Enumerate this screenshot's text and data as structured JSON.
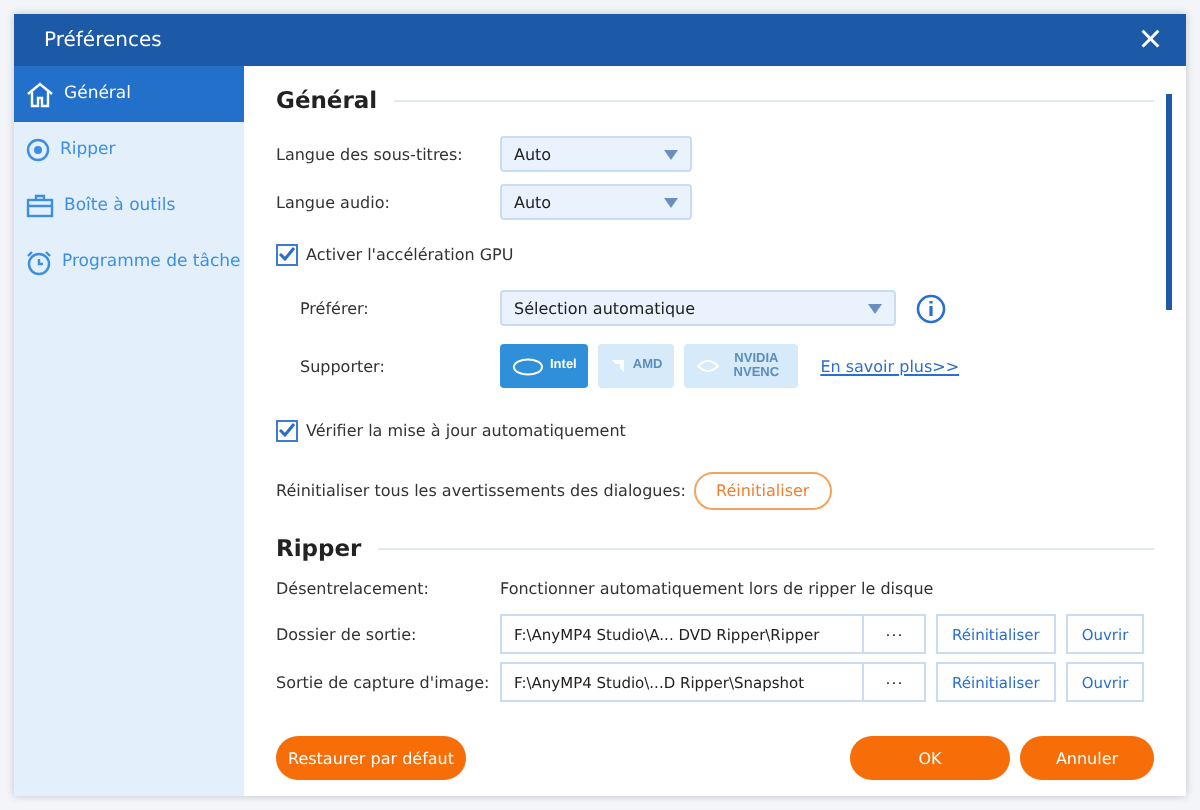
{
  "window": {
    "title": "Préférences",
    "close": "×"
  },
  "sidebar": {
    "items": [
      {
        "label": "Général",
        "selected": true
      },
      {
        "label": "Ripper",
        "selected": false
      },
      {
        "label": "Boîte à outils",
        "selected": false
      },
      {
        "label": "Programme de tâche",
        "selected": false
      }
    ]
  },
  "general": {
    "title": "Général",
    "subtitle_language": {
      "label": "Langue des sous-titres:",
      "value": "Auto"
    },
    "audio_language": {
      "label": "Langue audio:",
      "value": "Auto"
    },
    "gpu": {
      "label": "Activer l'accélération GPU",
      "checked": true,
      "prefer": {
        "label": "Préférer:",
        "value": "Sélection automatique"
      },
      "support": {
        "label": "Supporter:",
        "options": [
          {
            "kind": "intel",
            "label": "Intel",
            "enabled": true
          },
          {
            "kind": "amd",
            "label": "AMD",
            "enabled": false
          },
          {
            "kind": "nvidia",
            "label": "NVIDIA NVENC",
            "enabled": false
          }
        ],
        "link": "En savoir plus>>"
      }
    },
    "auto_update": {
      "label": "Vérifier la mise à jour automatiquement",
      "checked": true
    },
    "reset_warnings": {
      "label": "Réinitialiser tous les avertissements des dialogues:",
      "button": "Réinitialiser"
    }
  },
  "ripper": {
    "title": "Ripper",
    "deinterlace": {
      "label": "Désentrelacement:",
      "value": "Fonctionner automatiquement lors de ripper le disque"
    },
    "folders": [
      {
        "label": "Dossier de sortie:",
        "path": "F:\\AnyMP4 Studio\\A... DVD Ripper\\Ripper",
        "browse": "···",
        "reset": "Réinitialiser",
        "open": "Ouvrir"
      },
      {
        "label": "Sortie de capture d'image:",
        "path": "F:\\AnyMP4 Studio\\...D Ripper\\Snapshot",
        "browse": "···",
        "reset": "Réinitialiser",
        "open": "Ouvrir"
      }
    ]
  },
  "footer": {
    "restore": "Restaurer par défaut",
    "ok": "OK",
    "cancel": "Annuler"
  }
}
